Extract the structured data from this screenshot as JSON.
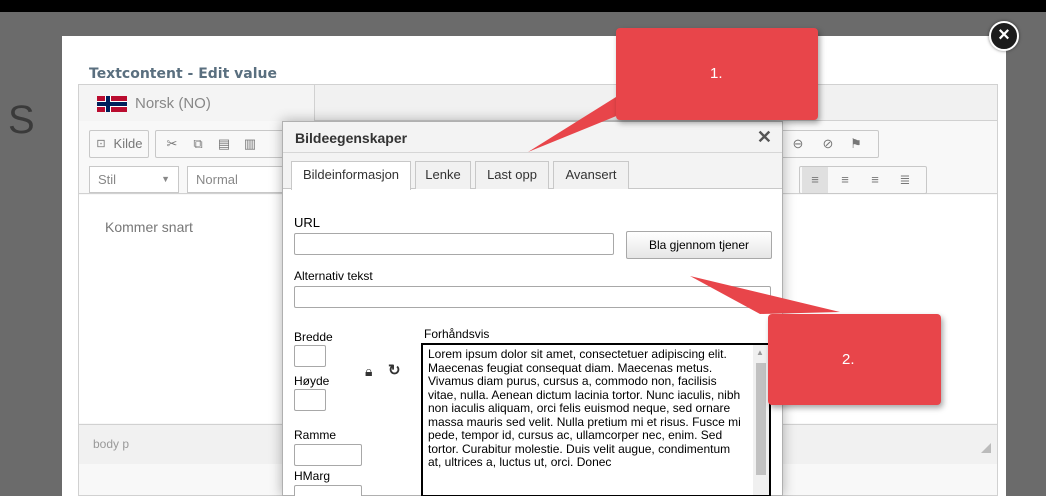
{
  "backdrop": {
    "letter": "S"
  },
  "overlay": {
    "close_icon": "close-circle-icon",
    "close_glyph": "×"
  },
  "editor": {
    "title": "Textcontent - Edit value",
    "language_tab": "Norsk (NO)",
    "toolbar": {
      "source_label": "Kilde",
      "style_combo": "Stil",
      "format_combo": "Normal"
    },
    "content_text": "Kommer snart",
    "status_path": "body  p"
  },
  "dialog": {
    "title": "Bildeegenskaper",
    "close_glyph": "✕",
    "tabs": [
      "Bildeinformasjon",
      "Lenke",
      "Last opp",
      "Avansert"
    ],
    "active_tab": "Bildeinformasjon",
    "url_label": "URL",
    "url_value": "",
    "browse_button": "Bla gjennom tjener",
    "alt_label": "Alternativ tekst",
    "alt_value": "",
    "width_label": "Bredde",
    "height_label": "Høyde",
    "border_label": "Ramme",
    "hspace_label": "HMarg",
    "preview_label": "Forhåndsvis",
    "preview_text": "Lorem ipsum dolor sit amet, consectetuer adipiscing elit. Maecenas feugiat consequat diam. Maecenas metus. Vivamus diam purus, cursus a, commodo non, facilisis vitae, nulla. Aenean dictum lacinia tortor. Nunc iaculis, nibh non iaculis aliquam, orci felis euismod neque, sed ornare massa mauris sed velit. Nulla pretium mi et risus. Fusce mi pede, tempor id, cursus ac, ullamcorper nec, enim. Sed tortor. Curabitur molestie. Duis velit augue, condimentum at, ultrices a, luctus ut, orci. Donec"
  },
  "callouts": [
    {
      "label": "1."
    },
    {
      "label": "2."
    }
  ],
  "colors": {
    "callout": "#e8454a",
    "editor_title": "#5a6f7f",
    "backdrop": "#6b6b6b"
  }
}
